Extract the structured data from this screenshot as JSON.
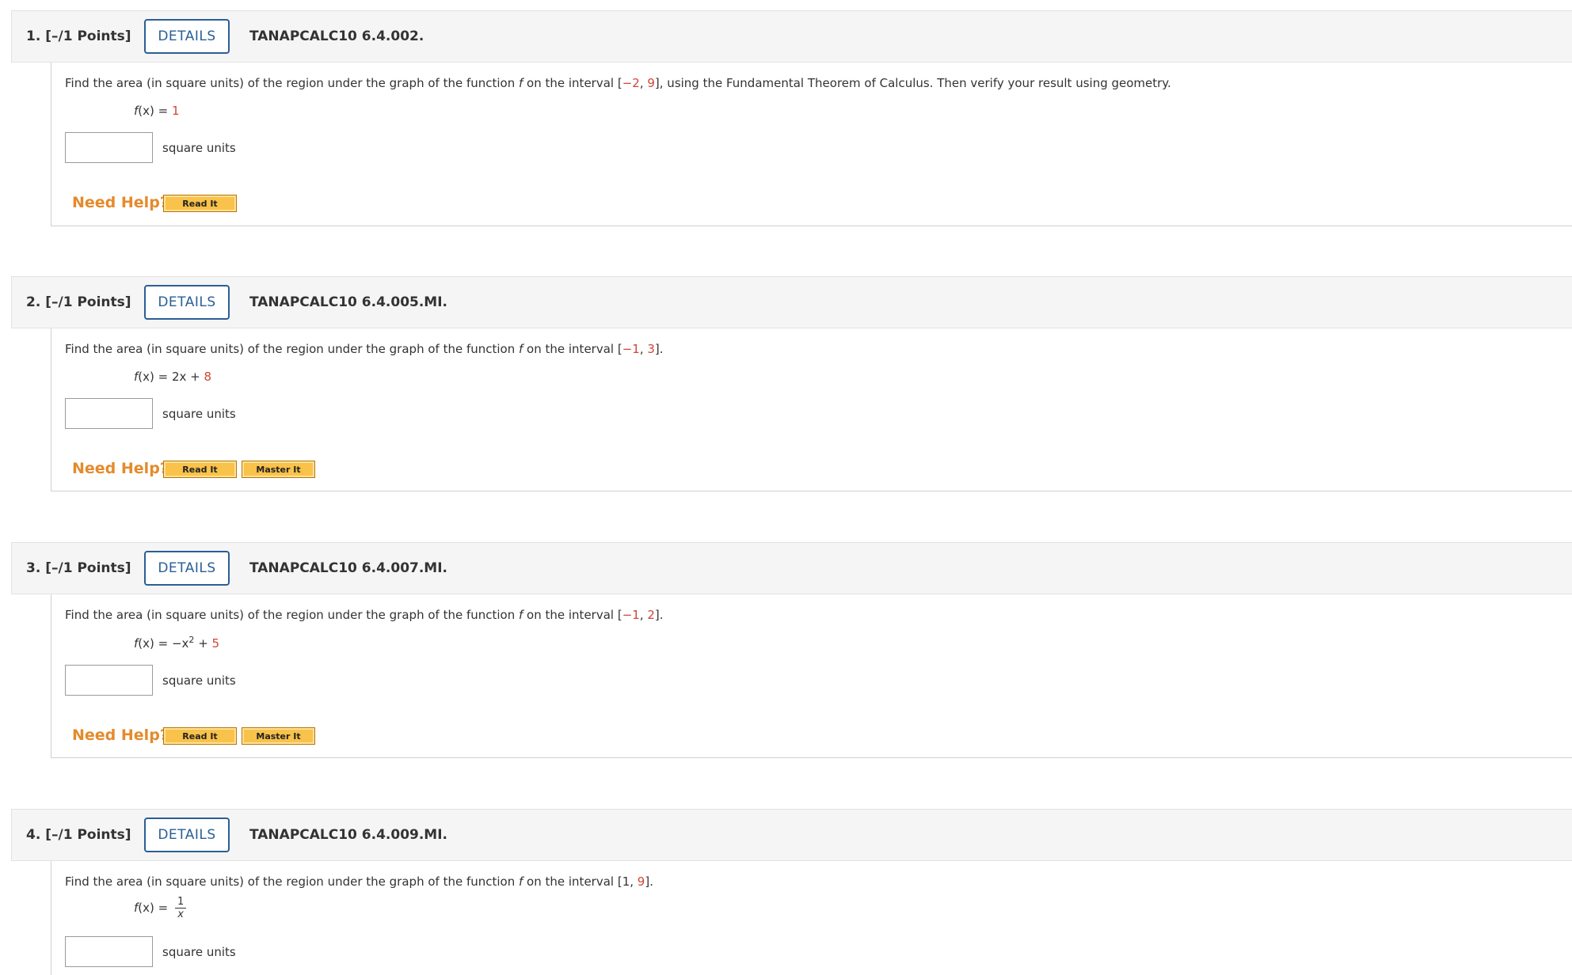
{
  "questions": [
    {
      "number": "1.",
      "points": "[–/1 Points]",
      "details_label": "DETAILS",
      "code": "TANAPCALC10 6.4.002.",
      "prompt_before": "Find the area (in square units) of the region under the graph of the function ",
      "prompt_f": "f",
      "prompt_mid": " on the interval [",
      "interval_a": "−2",
      "interval_sep": ", ",
      "interval_b": "9",
      "prompt_after": "], using the Fundamental Theorem of Calculus. Then verify your result using geometry.",
      "function_lhs": "f",
      "function_mid": "(x) = ",
      "function_const": "1",
      "answer_value": "",
      "units": "square units",
      "need_help": "Need Help?",
      "help_buttons": [
        "Read It"
      ]
    },
    {
      "number": "2.",
      "points": "[–/1 Points]",
      "details_label": "DETAILS",
      "code": "TANAPCALC10 6.4.005.MI.",
      "prompt_before": "Find the area (in square units) of the region under the graph of the function ",
      "prompt_f": "f",
      "prompt_mid": " on the interval [",
      "interval_a": "−1",
      "interval_sep": ", ",
      "interval_b": "3",
      "prompt_after": "].",
      "function_lhs": "f",
      "function_mid": "(x) = 2x + ",
      "function_const": "8",
      "answer_value": "",
      "units": "square units",
      "need_help": "Need Help?",
      "help_buttons": [
        "Read It",
        "Master It"
      ]
    },
    {
      "number": "3.",
      "points": "[–/1 Points]",
      "details_label": "DETAILS",
      "code": "TANAPCALC10 6.4.007.MI.",
      "prompt_before": "Find the area (in square units) of the region under the graph of the function ",
      "prompt_f": "f",
      "prompt_mid": " on the interval [",
      "interval_a": "−1",
      "interval_sep": ", ",
      "interval_b": "2",
      "prompt_after": "].",
      "function_lhs": "f",
      "function_mid": "(x) = −x",
      "function_exp": "2",
      "function_mid2": " + ",
      "function_const": "5",
      "answer_value": "",
      "units": "square units",
      "need_help": "Need Help?",
      "help_buttons": [
        "Read It",
        "Master It"
      ]
    },
    {
      "number": "4.",
      "points": "[–/1 Points]",
      "details_label": "DETAILS",
      "code": "TANAPCALC10 6.4.009.MI.",
      "prompt_before": "Find the area (in square units) of the region under the graph of the function ",
      "prompt_f": "f",
      "prompt_mid": " on the interval [",
      "interval_a": "1",
      "interval_sep": ", ",
      "interval_b": "9",
      "prompt_after": "].",
      "function_lhs": "f",
      "function_mid": "(x) = ",
      "frac_num": "1",
      "frac_den": "x",
      "answer_value": "",
      "units": "square units"
    }
  ]
}
